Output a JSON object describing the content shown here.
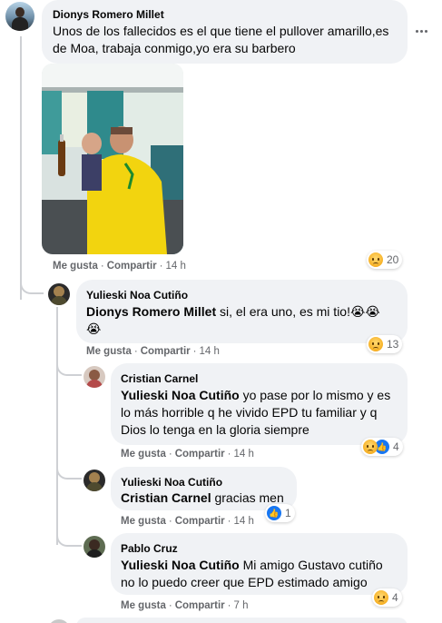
{
  "more_icon": "more-horizontal-icon",
  "comments": [
    {
      "author": "Dionys Romero Millet",
      "text": "Unos de los fallecidos es el que tiene el pullover amarillo,es de Moa, trabaja conmigo,yo era su barbero",
      "like_label": "Me gusta",
      "share_label": "Compartir",
      "time": "14 h",
      "reaction_count": "20"
    },
    {
      "author": "Yulieski Noa Cutiño",
      "mention": "Dionys Romero Millet",
      "text": "si, el era uno, es mi tio!😭😭",
      "text2": "😭",
      "like_label": "Me gusta",
      "share_label": "Compartir",
      "time": "14 h",
      "reaction_count": "13"
    },
    {
      "author": "Cristian Carnel",
      "mention": "Yulieski Noa Cutiño",
      "text": "yo pase por lo mismo y es lo más horrible q he vivido EPD tu familiar y q Dios lo tenga en la gloria siempre",
      "like_label": "Me gusta",
      "share_label": "Compartir",
      "time": "14 h",
      "reaction_count": "4"
    },
    {
      "author": "Yulieski Noa Cutiño",
      "mention": "Cristian Carnel",
      "text": "gracias men",
      "like_label": "Me gusta",
      "share_label": "Compartir",
      "time": "14 h",
      "reaction_count": "1"
    },
    {
      "author": "Pablo Cruz",
      "mention": "Yulieski Noa Cutiño",
      "text": "Mi amigo Gustavo cutiño no lo puedo creer que EPD estimado amigo",
      "like_label": "Me gusta",
      "share_label": "Compartir",
      "time": "7 h",
      "reaction_count": "4"
    }
  ]
}
